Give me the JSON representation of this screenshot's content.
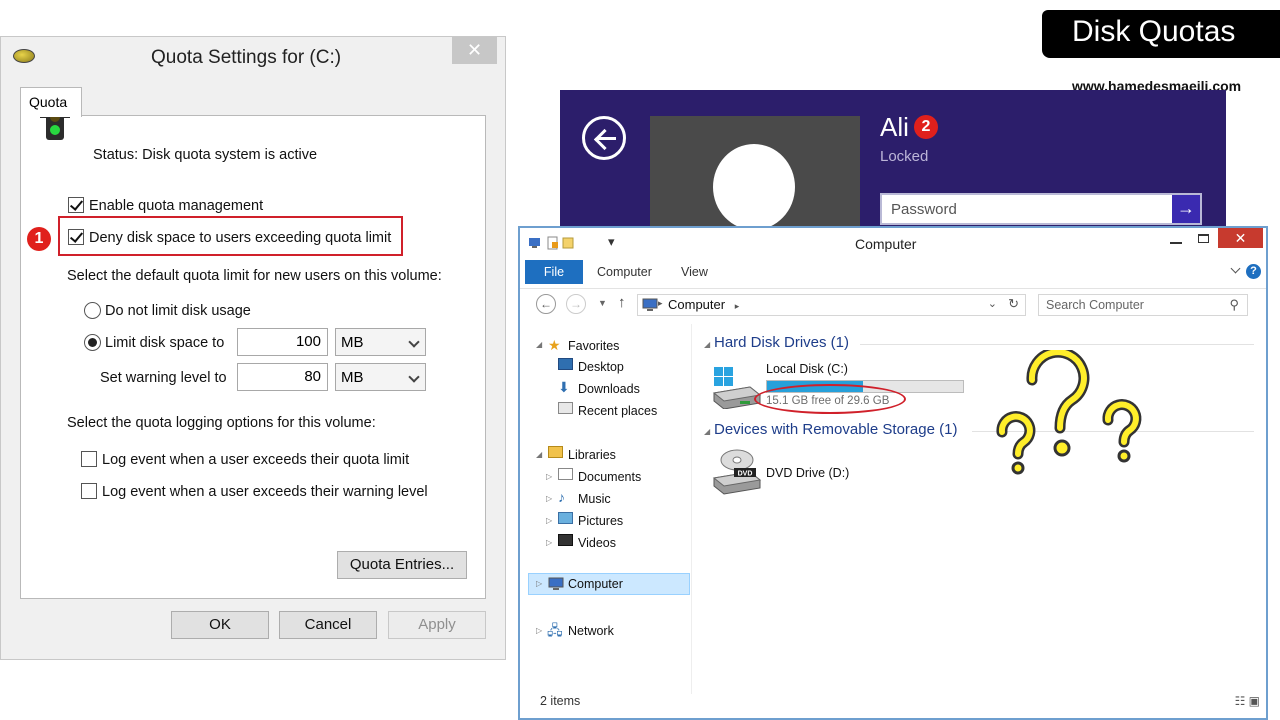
{
  "quota_dialog": {
    "title": "Quota Settings for  (C:)",
    "close": "✕",
    "tab": "Quota",
    "status": "Status:  Disk quota system is active",
    "enable_quota": "Enable quota management",
    "enable_quota_checked": true,
    "deny_space": "Deny disk space to users exceeding quota limit",
    "deny_space_checked": true,
    "badge_1": "1",
    "default_limit_heading": "Select the default quota limit for new users on this volume:",
    "no_limit": "Do not limit disk usage",
    "limit_to": "Limit disk space to",
    "limit_value": "100",
    "limit_unit": "MB",
    "warning_label": "Set warning level to",
    "warning_value": "80",
    "warning_unit": "MB",
    "logging_heading": "Select the quota logging options for this volume:",
    "log_limit": "Log event when a user exceeds their quota limit",
    "log_warning": "Log event when a user exceeds their warning level",
    "entries_button": "Quota Entries...",
    "ok": "OK",
    "cancel": "Cancel",
    "apply": "Apply"
  },
  "brand": {
    "title": "Disk Quotas",
    "site": "www.hamedesmaeili.com"
  },
  "lock_screen": {
    "user": "Ali",
    "badge_2": "2",
    "state": "Locked",
    "password_placeholder": "Password",
    "submit": "→"
  },
  "explorer": {
    "title": "Computer",
    "quick_access": "▾",
    "tabs": [
      "File",
      "Computer",
      "View"
    ],
    "help": "?",
    "address": "Computer",
    "search_placeholder": "Search Computer",
    "nav": {
      "favorites": "Favorites",
      "desktop": "Desktop",
      "downloads": "Downloads",
      "recent": "Recent places",
      "libraries": "Libraries",
      "documents": "Documents",
      "music": "Music",
      "pictures": "Pictures",
      "videos": "Videos",
      "computer": "Computer",
      "network": "Network"
    },
    "group_hdd": "Hard Disk Drives (1)",
    "group_removable": "Devices with Removable Storage (1)",
    "local_disk": "Local Disk (C:)",
    "local_disk_free": "15.1 GB free of 29.6 GB",
    "local_disk_used_fraction": 0.49,
    "dvd": "DVD Drive (D:)",
    "dvd_label": "DVD",
    "status": "2 items"
  }
}
